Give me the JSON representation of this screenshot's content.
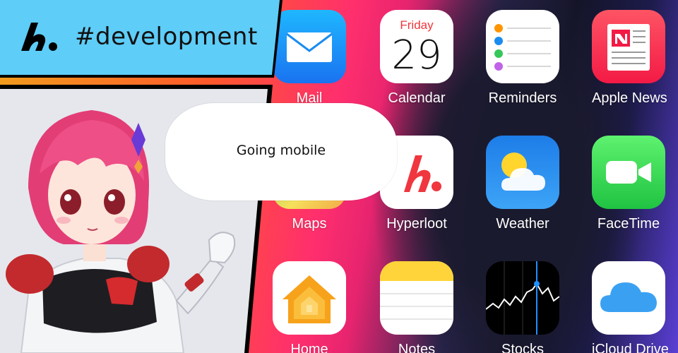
{
  "banner": {
    "hashtag": "#development"
  },
  "bubble": {
    "text": "Going mobile"
  },
  "calendar_icon": {
    "weekday": "Friday",
    "day": "29"
  },
  "apps": [
    {
      "label": "Mail",
      "icon": "mail-icon"
    },
    {
      "label": "Calendar",
      "icon": "calendar-icon"
    },
    {
      "label": "Reminders",
      "icon": "reminders-icon"
    },
    {
      "label": "Apple News",
      "icon": "news-icon"
    },
    {
      "label": "Maps",
      "icon": "maps-icon"
    },
    {
      "label": "Hyperloot",
      "icon": "hyperloot-logo-icon"
    },
    {
      "label": "Weather",
      "icon": "weather-icon"
    },
    {
      "label": "FaceTime",
      "icon": "facetime-icon"
    },
    {
      "label": "Home",
      "icon": "home-icon"
    },
    {
      "label": "Notes",
      "icon": "notes-icon"
    },
    {
      "label": "Stocks",
      "icon": "stocks-icon"
    },
    {
      "label": "iCloud Drive",
      "icon": "icloud-icon"
    }
  ],
  "colors": {
    "banner_bg": "#5ecdf8",
    "brand_red": "#f0363f",
    "facetime_green": "#35d04d",
    "weather_blue": "#2b8ff0"
  }
}
